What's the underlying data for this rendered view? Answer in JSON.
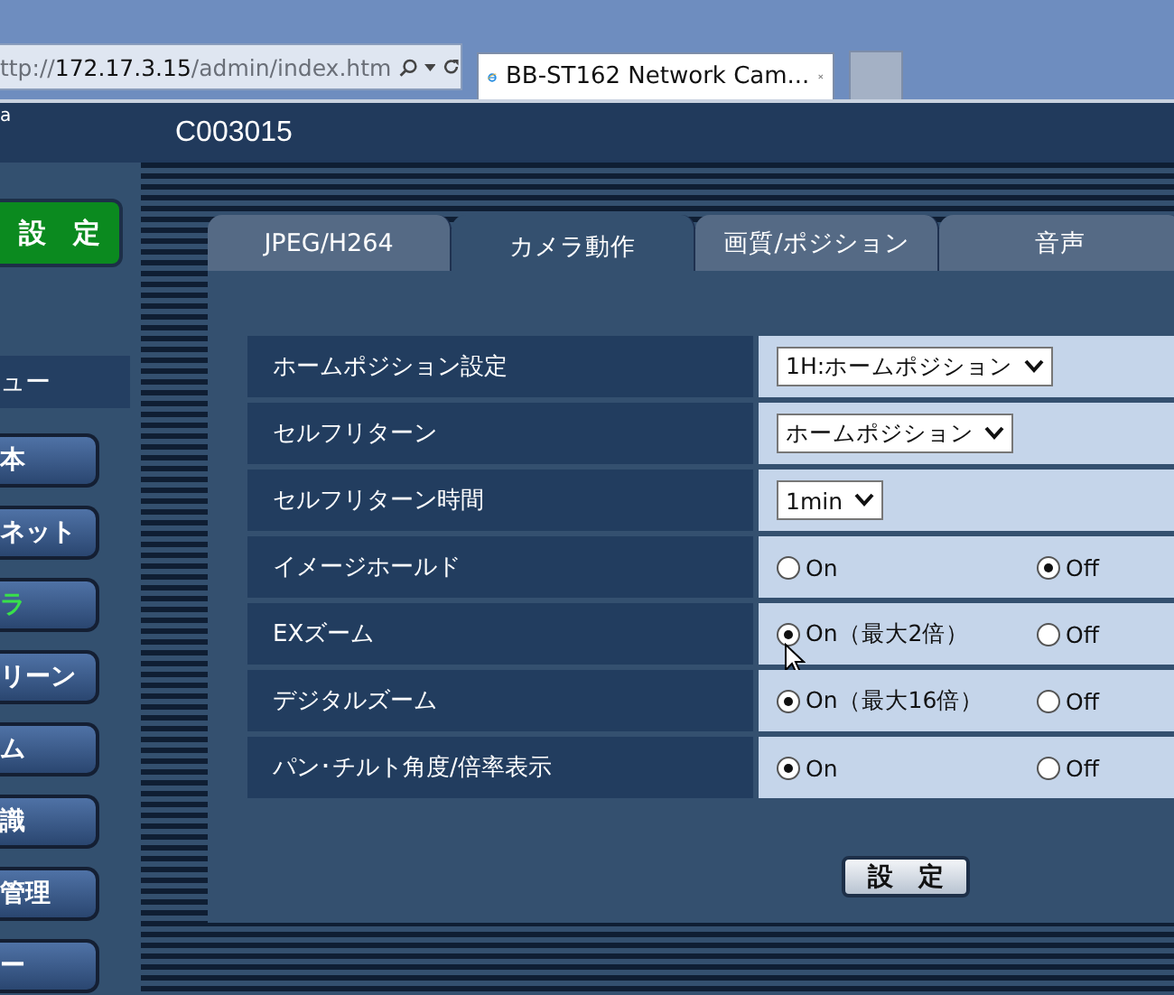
{
  "browser": {
    "address": {
      "prefix": "ttp://",
      "host": "172.17.3.15",
      "path": "/admin/index.htm"
    },
    "tabs": [
      {
        "title": "BB-ST162 Network Cam...",
        "selected": true
      }
    ]
  },
  "header": {
    "corner": "a",
    "camera_name": "C003015"
  },
  "sidebar": {
    "setup_button": "設　定",
    "menu_title": "ュー",
    "items": [
      {
        "label": "本",
        "selected": false
      },
      {
        "label": "ネット",
        "selected": false
      },
      {
        "label": "ラ",
        "selected": true
      },
      {
        "label": "リーン",
        "selected": false
      },
      {
        "label": "ム",
        "selected": false
      },
      {
        "label": "識",
        "selected": false
      },
      {
        "label": "管理",
        "selected": false
      },
      {
        "label": "ー",
        "selected": false
      }
    ]
  },
  "tabs": [
    {
      "label": "JPEG/H264",
      "selected": false
    },
    {
      "label": "カメラ動作",
      "selected": true
    },
    {
      "label": "画質/ポジション",
      "selected": false
    },
    {
      "label": "音声",
      "selected": false
    }
  ],
  "settings": [
    {
      "kind": "select",
      "label": "ホームポジション設定",
      "value": "1H:ホームポジション"
    },
    {
      "kind": "select",
      "label": "セルフリターン",
      "value": "ホームポジション"
    },
    {
      "kind": "select",
      "label": "セルフリターン時間",
      "value": "1min"
    },
    {
      "kind": "radio",
      "label": "イメージホールド",
      "options": [
        {
          "label": "On",
          "selected": false
        },
        {
          "label": "Off",
          "selected": true
        }
      ]
    },
    {
      "kind": "radio",
      "label": "EXズーム",
      "options": [
        {
          "label": "On（最大2倍）",
          "selected": true
        },
        {
          "label": "Off",
          "selected": false
        }
      ]
    },
    {
      "kind": "radio",
      "label": "デジタルズーム",
      "options": [
        {
          "label": "On（最大16倍）",
          "selected": true
        },
        {
          "label": "Off",
          "selected": false
        }
      ]
    },
    {
      "kind": "radio",
      "label": "パン･チルト角度/倍率表示",
      "options": [
        {
          "label": "On",
          "selected": true
        },
        {
          "label": "Off",
          "selected": false
        }
      ]
    }
  ],
  "submit_button": "設　定"
}
